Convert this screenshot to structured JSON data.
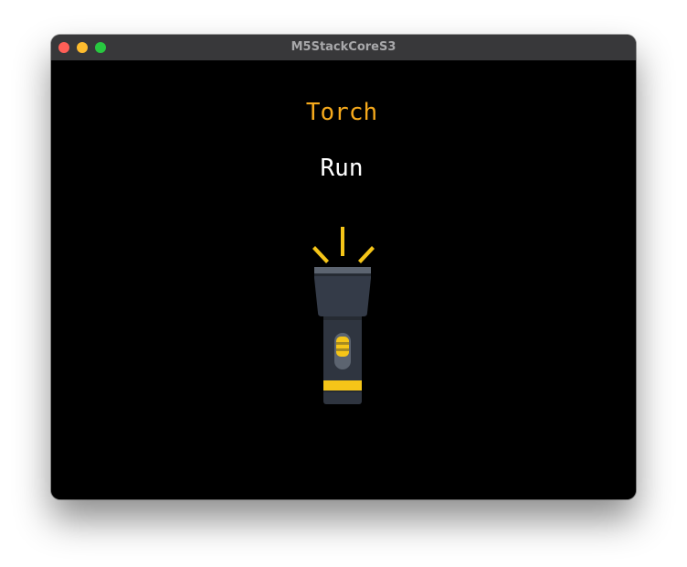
{
  "window": {
    "title": "M5StackCoreS3",
    "controls": [
      "close",
      "minimize",
      "maximize"
    ]
  },
  "app": {
    "title": "Torch",
    "status": "Run",
    "icon": "flashlight-icon"
  },
  "colors": {
    "title_accent": "#f5a91c",
    "status_text": "#ffffff",
    "screen_background": "#000000",
    "torch_body": "#2f3540",
    "torch_band": "#f5c518"
  }
}
